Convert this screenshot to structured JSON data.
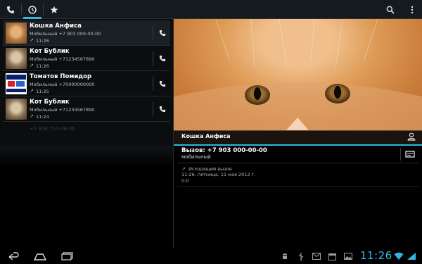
{
  "action_bar": {
    "tabs": [
      {
        "icon": "phone-icon",
        "active": false
      },
      {
        "icon": "clock-icon",
        "active": true
      },
      {
        "icon": "star-icon",
        "active": false
      }
    ],
    "actions": [
      "search-icon",
      "overflow-menu-icon"
    ]
  },
  "call_log": {
    "items": [
      {
        "name": "Кошка Анфиса",
        "number": "Мобильный +7 903 000-00-00",
        "time": "11:26",
        "thumb": "cat"
      },
      {
        "name": "Кот Бублик",
        "number": "Мобильный +71234567890",
        "time": "11:26",
        "thumb": "cat-b"
      },
      {
        "name": "Томатов Помидор",
        "number": "Мобильный +70000000000",
        "time": "11:25",
        "thumb": "tomato"
      },
      {
        "name": "Кот Бублик",
        "number": "Мобильный +71234567890",
        "time": "11:24",
        "thumb": "cat-b"
      }
    ],
    "ghost_text": "+7 916 710-26-36"
  },
  "detail": {
    "contact_name": "Кошка Анфиса",
    "call_label": "Вызов: +7 903 000-00-00",
    "call_type": "мобильный",
    "history": {
      "label": "Исходящий вызов",
      "date": "11:26, пятница, 11 мая 2012 г.",
      "duration": "0:0"
    }
  },
  "system_bar": {
    "clock": "11:26",
    "nav": [
      "back-icon",
      "home-icon",
      "recents-icon"
    ],
    "status_icons": [
      "android-debug-icon",
      "usb-icon",
      "gmail-icon",
      "calendar-icon",
      "image-icon",
      "wifi-icon",
      "signal-icon"
    ]
  },
  "colors": {
    "accent": "#33b5e5",
    "outgoing": "#8dd12b",
    "background": "#000000"
  }
}
